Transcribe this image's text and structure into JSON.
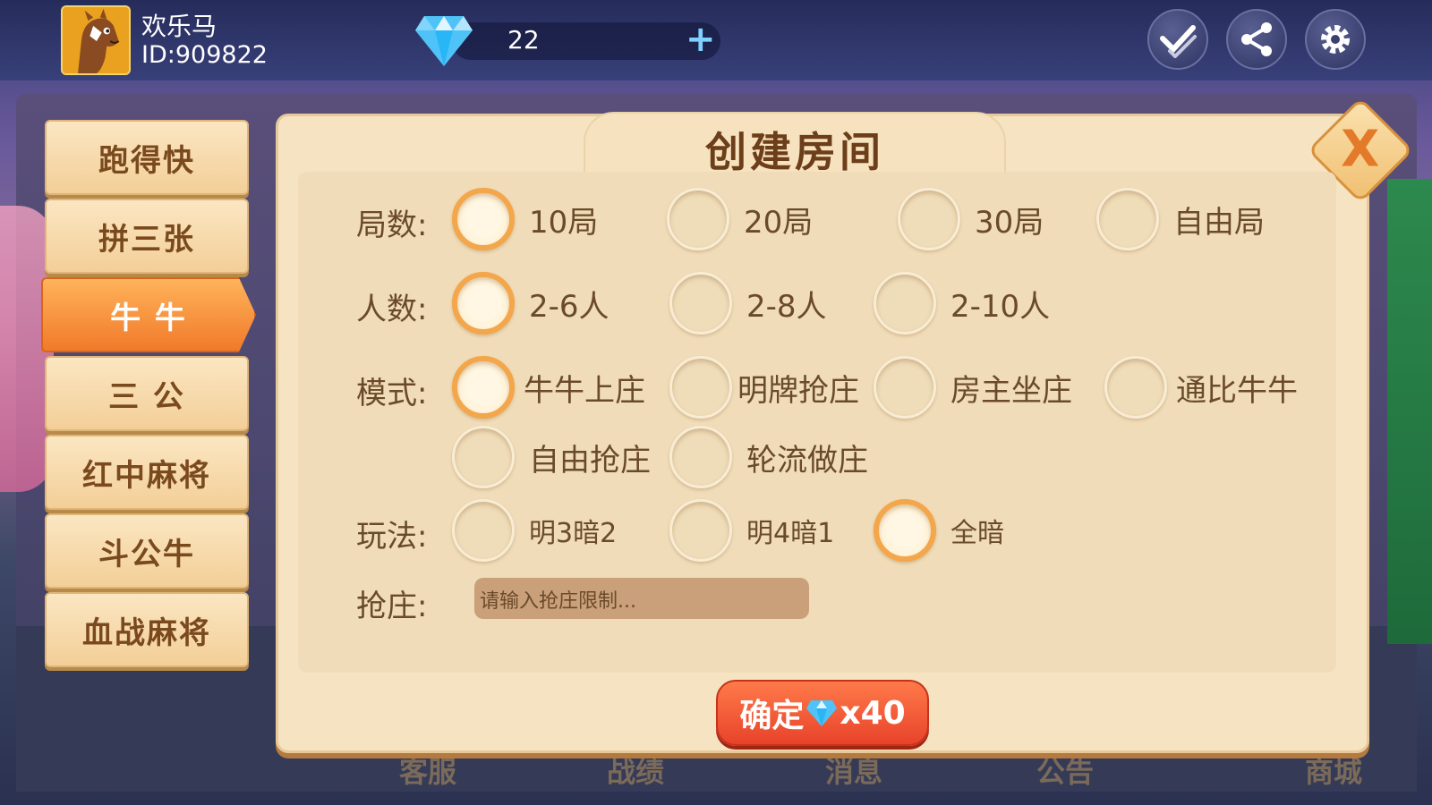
{
  "user": {
    "nickname": "欢乐马",
    "id_text": "ID:909822"
  },
  "currency": {
    "diamonds": "22",
    "plus": "+"
  },
  "header_buttons": [
    "checkmark-icon",
    "share-icon",
    "gear-icon"
  ],
  "sidebar": {
    "items": [
      {
        "label": "跑得快",
        "active": false
      },
      {
        "label": "拼三张",
        "active": false
      },
      {
        "label": "牛 牛",
        "active": true
      },
      {
        "label": "三 公",
        "active": false
      },
      {
        "label": "红中麻将",
        "active": false
      },
      {
        "label": "斗公牛",
        "active": false
      },
      {
        "label": "血战麻将",
        "active": false
      }
    ]
  },
  "dialog": {
    "title": "创建房间",
    "close": "X",
    "rounds": {
      "label": "局数:",
      "options": [
        "10局",
        "20局",
        "30局",
        "自由局"
      ],
      "selected": 0
    },
    "players": {
      "label": "人数:",
      "options": [
        "2-6人",
        "2-8人",
        "2-10人"
      ],
      "selected": 0
    },
    "mode": {
      "label": "模式:",
      "options": [
        "牛牛上庄",
        "明牌抢庄",
        "房主坐庄",
        "通比牛牛",
        "自由抢庄",
        "轮流做庄"
      ],
      "selected": 0
    },
    "play": {
      "label": "玩法:",
      "options": [
        "明3暗2",
        "明4暗1",
        "全暗"
      ],
      "selected": 2
    },
    "grab": {
      "label": "抢庄:",
      "placeholder": "请输入抢庄限制..."
    },
    "confirm": {
      "text": "确定",
      "cost": "x40"
    }
  },
  "bottom_nav": [
    "客服",
    "战绩",
    "消息",
    "公告",
    "商城"
  ],
  "colors": {
    "accent": "#f07a2a",
    "panel": "#f5e3c2",
    "text": "#6a4a2a",
    "confirm": "#e8432a"
  }
}
